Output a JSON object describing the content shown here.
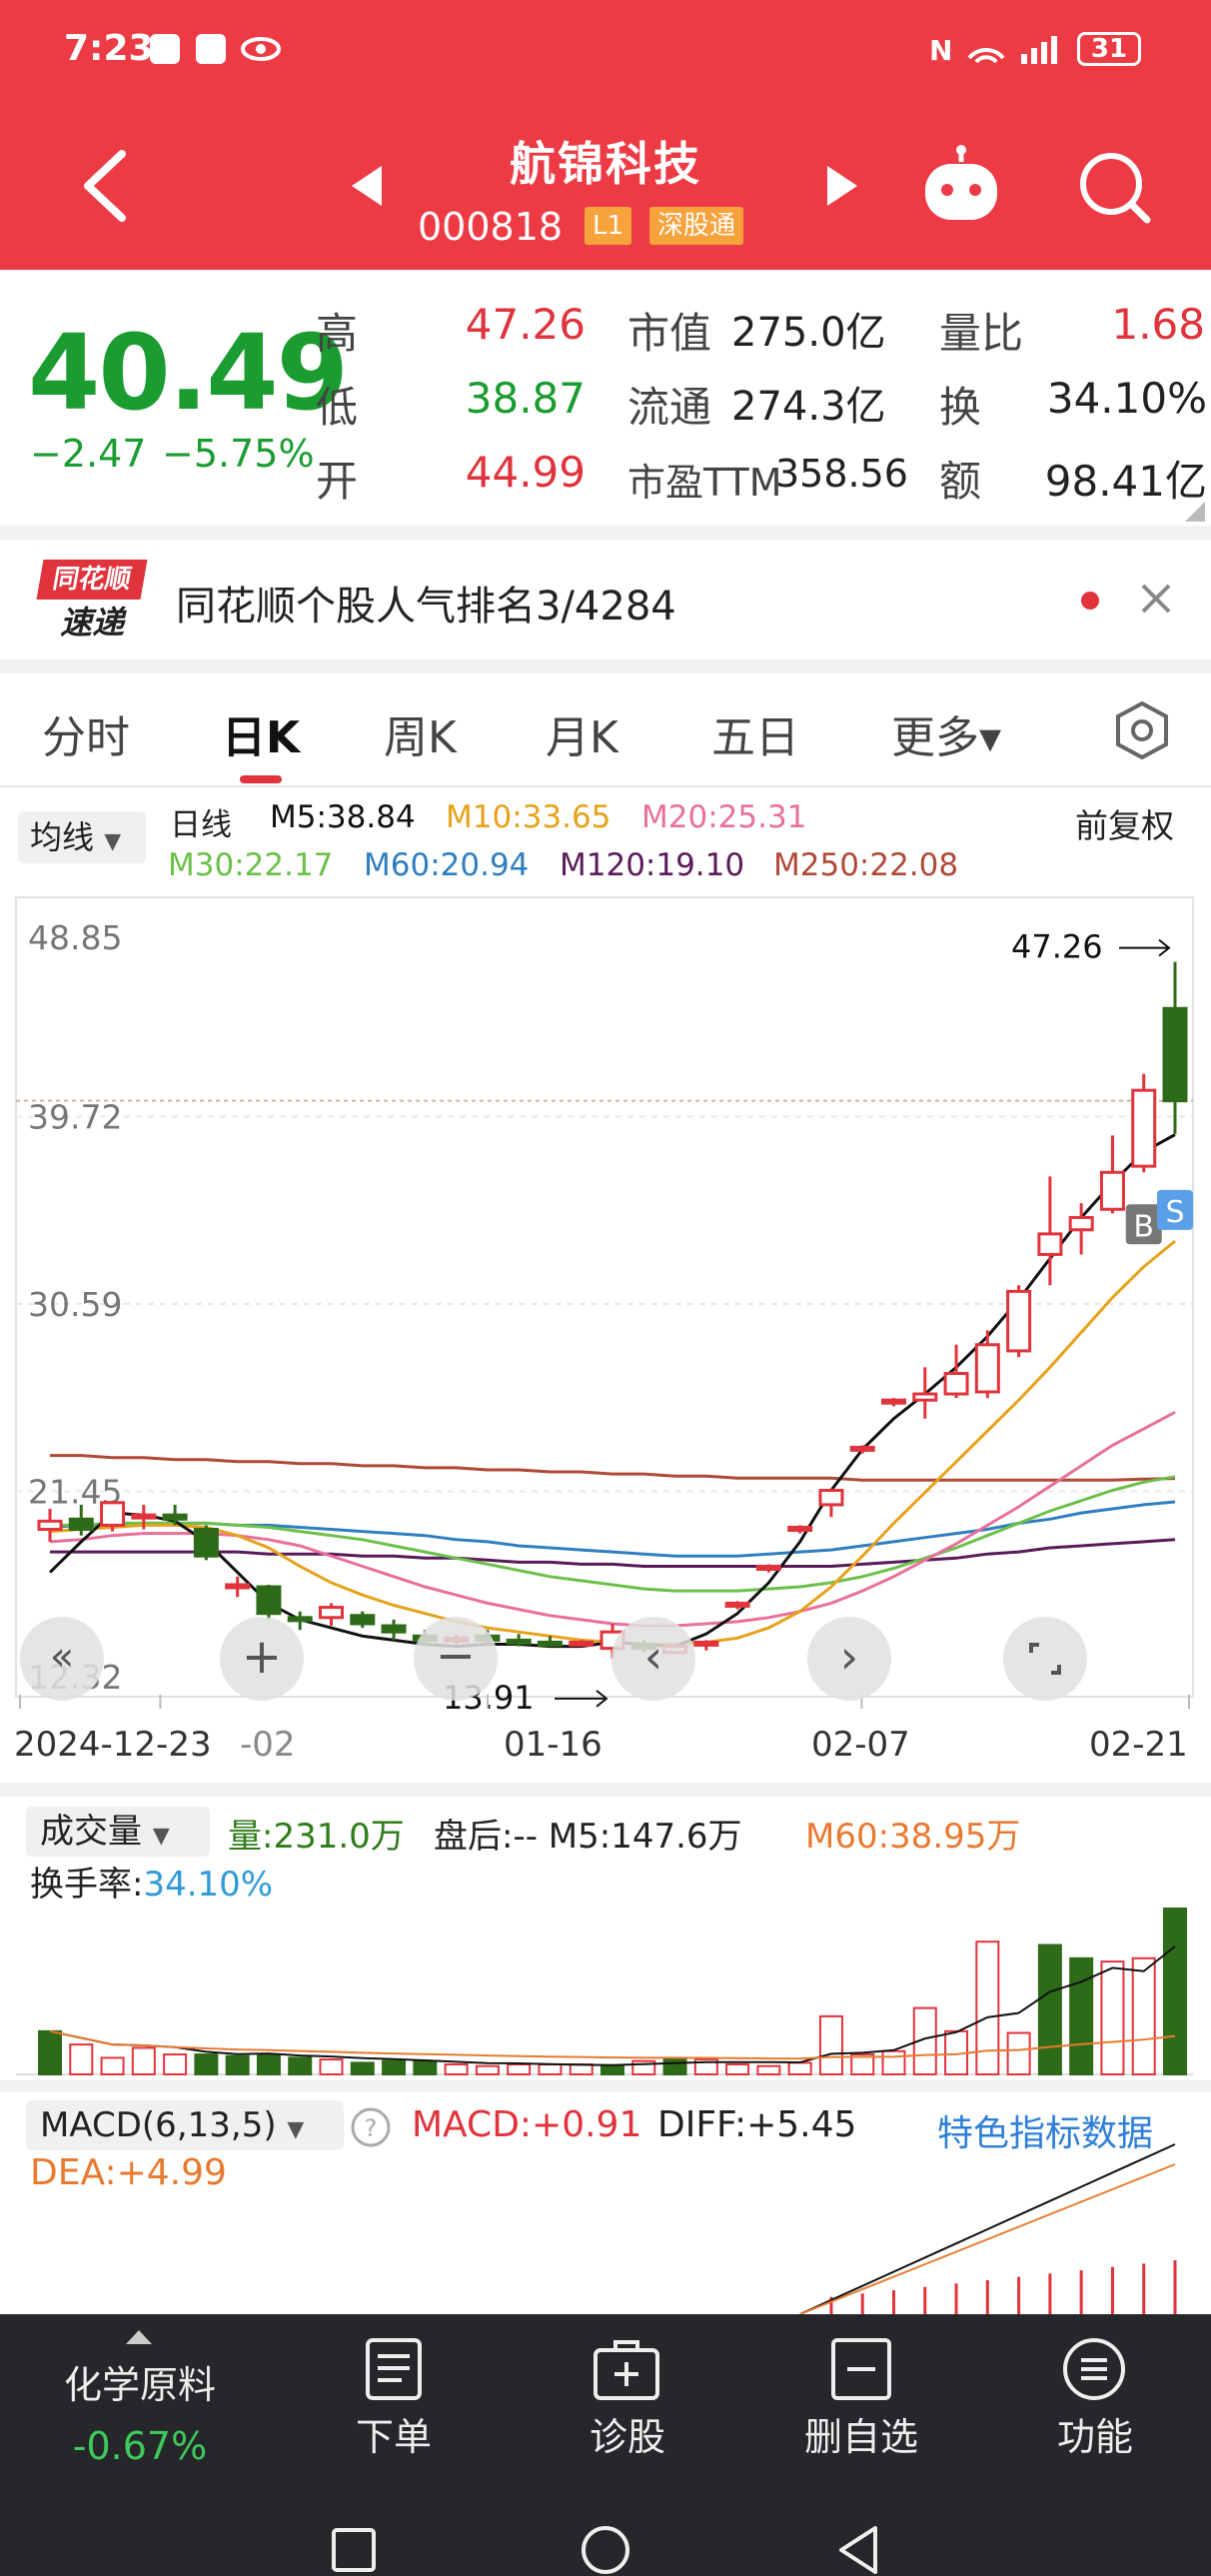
{
  "status_bar": {
    "time": "7:23",
    "battery": "31"
  },
  "header": {
    "stock_name": "航锦科技",
    "stock_code": "000818",
    "level_tag": "L1",
    "connect_tag": "深股通"
  },
  "quote": {
    "price": "40.49",
    "change": "−2.47",
    "change_pct": "−5.75%",
    "high_label": "高",
    "high": "47.26",
    "low_label": "低",
    "low": "38.87",
    "open_label": "开",
    "open": "44.99",
    "mktcap_label": "市值",
    "mktcap": "275.0亿",
    "float_label": "流通",
    "float": "274.3亿",
    "pe_label": "市盈TTM",
    "pe": "358.56",
    "volratio_label": "量比",
    "volratio": "1.68",
    "turnover_label": "换",
    "turnover": "34.10%",
    "amount_label": "额",
    "amount": "98.41亿"
  },
  "banner": {
    "logo_top": "同花顺",
    "logo_bottom": "速递",
    "text": "同花顺个股人气排名3/4284"
  },
  "tabs": [
    {
      "label": "分时"
    },
    {
      "label": "日K"
    },
    {
      "label": "周K"
    },
    {
      "label": "月K"
    },
    {
      "label": "五日"
    },
    {
      "label": "更多▾"
    }
  ],
  "indicator": {
    "selector": "均线",
    "period": "日线",
    "adjust": "前复权",
    "ma5": "M5:38.84",
    "ma10": "M10:33.65",
    "ma20": "M20:25.31",
    "ma30": "M30:22.17",
    "ma60": "M60:20.94",
    "ma120": "M120:19.10",
    "ma250": "M250:22.08"
  },
  "colors": {
    "ma5": "#111111",
    "ma10": "#e6a21a",
    "ma20": "#e8709a",
    "ma30": "#6cc04a",
    "ma60": "#2f7fc0",
    "ma120": "#5a1a5a",
    "ma250": "#b04a38",
    "up": "#e0333c",
    "down": "#2e6b18"
  },
  "chart_data": {
    "type": "candlestick",
    "y_ticks": [
      "48.85",
      "39.72",
      "30.59",
      "21.45",
      "12.32"
    ],
    "x_ticks": [
      "2024-12-23",
      "-02",
      "01-16",
      "02-07",
      "02-21"
    ],
    "high_marker": "47.26",
    "low_marker": "13.91",
    "buy_marker": "B",
    "sell_marker": "S",
    "ylim": [
      12.32,
      48.85
    ],
    "candles": [
      {
        "o": 19.6,
        "h": 20.6,
        "l": 19.0,
        "c": 20.0
      },
      {
        "o": 20.1,
        "h": 20.8,
        "l": 19.3,
        "c": 19.6
      },
      {
        "o": 19.8,
        "h": 21.0,
        "l": 19.5,
        "c": 20.9
      },
      {
        "o": 20.2,
        "h": 20.8,
        "l": 19.6,
        "c": 20.3
      },
      {
        "o": 20.3,
        "h": 20.8,
        "l": 19.8,
        "c": 20.1
      },
      {
        "o": 19.6,
        "h": 19.8,
        "l": 18.1,
        "c": 18.3
      },
      {
        "o": 16.8,
        "h": 17.3,
        "l": 16.3,
        "c": 16.9
      },
      {
        "o": 16.8,
        "h": 16.9,
        "l": 15.2,
        "c": 15.5
      },
      {
        "o": 15.3,
        "h": 15.6,
        "l": 14.7,
        "c": 15.2
      },
      {
        "o": 15.3,
        "h": 16.0,
        "l": 14.9,
        "c": 15.8
      },
      {
        "o": 15.4,
        "h": 15.6,
        "l": 14.8,
        "c": 15.0
      },
      {
        "o": 14.9,
        "h": 15.2,
        "l": 14.2,
        "c": 14.6
      },
      {
        "o": 14.4,
        "h": 14.7,
        "l": 13.9,
        "c": 14.2
      },
      {
        "o": 14.2,
        "h": 14.5,
        "l": 14.0,
        "c": 14.3
      },
      {
        "o": 14.4,
        "h": 14.7,
        "l": 14.0,
        "c": 14.2
      },
      {
        "o": 14.2,
        "h": 14.5,
        "l": 13.9,
        "c": 14.1
      },
      {
        "o": 14.1,
        "h": 14.4,
        "l": 13.9,
        "c": 14.0
      },
      {
        "o": 14.0,
        "h": 14.2,
        "l": 13.9,
        "c": 14.1
      },
      {
        "o": 13.8,
        "h": 15.0,
        "l": 13.3,
        "c": 14.6
      },
      {
        "o": 14.0,
        "h": 14.2,
        "l": 13.6,
        "c": 13.8
      },
      {
        "o": 13.6,
        "h": 14.0,
        "l": 13.5,
        "c": 13.9
      },
      {
        "o": 14.0,
        "h": 14.2,
        "l": 13.7,
        "c": 14.1
      },
      {
        "o": 15.9,
        "h": 16.1,
        "l": 15.7,
        "c": 16.0
      },
      {
        "o": 17.7,
        "h": 17.9,
        "l": 17.5,
        "c": 17.8
      },
      {
        "o": 19.6,
        "h": 19.8,
        "l": 19.4,
        "c": 19.7
      },
      {
        "o": 20.8,
        "h": 21.6,
        "l": 20.2,
        "c": 21.5
      },
      {
        "o": 23.5,
        "h": 23.7,
        "l": 23.3,
        "c": 23.6
      },
      {
        "o": 25.8,
        "h": 26.0,
        "l": 25.6,
        "c": 25.9
      },
      {
        "o": 25.9,
        "h": 27.5,
        "l": 25.0,
        "c": 26.2
      },
      {
        "o": 26.2,
        "h": 28.6,
        "l": 26.0,
        "c": 27.2
      },
      {
        "o": 26.3,
        "h": 29.3,
        "l": 26.0,
        "c": 28.6
      },
      {
        "o": 28.3,
        "h": 31.5,
        "l": 28.0,
        "c": 31.2
      },
      {
        "o": 33.0,
        "h": 36.8,
        "l": 31.5,
        "c": 34.0
      },
      {
        "o": 34.2,
        "h": 35.5,
        "l": 33.0,
        "c": 34.8
      },
      {
        "o": 35.2,
        "h": 38.8,
        "l": 35.0,
        "c": 37.0
      },
      {
        "o": 37.3,
        "h": 41.8,
        "l": 37.0,
        "c": 41.0
      },
      {
        "o": 44.99,
        "h": 47.26,
        "l": 38.87,
        "c": 40.49
      }
    ],
    "ma": {
      "ma5": [
        17.5,
        19.0,
        20.4,
        20.3,
        20.0,
        19.0,
        17.5,
        16.0,
        15.2,
        14.8,
        14.4,
        14.2,
        14.0,
        13.9,
        14.0,
        14.0,
        13.9,
        13.9,
        14.1,
        14.0,
        13.9,
        14.5,
        15.5,
        17.0,
        19.0,
        21.5,
        23.5,
        25.0,
        26.2,
        27.5,
        29.0,
        30.8,
        32.8,
        34.8,
        36.5,
        38.0,
        38.84
      ],
      "ma10": [
        19.5,
        19.6,
        19.7,
        19.8,
        19.8,
        19.7,
        19.3,
        18.7,
        17.8,
        17.0,
        16.4,
        15.9,
        15.5,
        15.1,
        14.8,
        14.6,
        14.4,
        14.2,
        14.1,
        14.0,
        14.0,
        14.1,
        14.3,
        14.8,
        15.6,
        16.8,
        18.3,
        19.9,
        21.4,
        22.9,
        24.4,
        25.9,
        27.5,
        29.2,
        30.9,
        32.4,
        33.65
      ],
      "ma20": [
        19.0,
        19.1,
        19.3,
        19.4,
        19.4,
        19.4,
        19.3,
        19.1,
        18.8,
        18.3,
        17.8,
        17.3,
        16.8,
        16.4,
        16.0,
        15.7,
        15.4,
        15.2,
        15.0,
        14.9,
        14.9,
        15.0,
        15.1,
        15.3,
        15.6,
        16.0,
        16.6,
        17.3,
        18.1,
        18.9,
        19.8,
        20.7,
        21.7,
        22.7,
        23.7,
        24.5,
        25.31
      ],
      "ma30": [
        19.8,
        19.8,
        19.9,
        19.9,
        19.9,
        19.9,
        19.8,
        19.7,
        19.5,
        19.3,
        19.1,
        18.8,
        18.5,
        18.2,
        17.9,
        17.6,
        17.3,
        17.1,
        16.9,
        16.7,
        16.6,
        16.6,
        16.6,
        16.7,
        16.8,
        17.0,
        17.3,
        17.7,
        18.2,
        18.7,
        19.3,
        19.9,
        20.5,
        21.0,
        21.5,
        21.9,
        22.17
      ],
      "ma60": [
        19.7,
        19.8,
        19.8,
        19.9,
        19.9,
        19.9,
        19.8,
        19.8,
        19.7,
        19.6,
        19.5,
        19.4,
        19.3,
        19.1,
        19.0,
        18.8,
        18.7,
        18.6,
        18.5,
        18.4,
        18.3,
        18.3,
        18.3,
        18.4,
        18.5,
        18.6,
        18.8,
        19.0,
        19.2,
        19.4,
        19.6,
        19.9,
        20.1,
        20.4,
        20.6,
        20.8,
        20.94
      ],
      "ma120": [
        18.5,
        18.5,
        18.5,
        18.5,
        18.5,
        18.5,
        18.5,
        18.4,
        18.4,
        18.4,
        18.3,
        18.3,
        18.2,
        18.2,
        18.1,
        18.0,
        18.0,
        17.9,
        17.9,
        17.8,
        17.8,
        17.8,
        17.8,
        17.8,
        17.8,
        17.8,
        17.9,
        18.0,
        18.1,
        18.2,
        18.4,
        18.5,
        18.7,
        18.8,
        18.9,
        19.0,
        19.1
      ],
      "ma250": [
        23.2,
        23.2,
        23.1,
        23.1,
        23.0,
        23.0,
        22.9,
        22.9,
        22.8,
        22.8,
        22.7,
        22.7,
        22.6,
        22.6,
        22.5,
        22.5,
        22.4,
        22.4,
        22.3,
        22.3,
        22.2,
        22.2,
        22.1,
        22.1,
        22.1,
        22.1,
        22.0,
        22.0,
        22.0,
        22.0,
        22.0,
        22.0,
        22.0,
        22.0,
        22.0,
        22.05,
        22.08
      ]
    },
    "volume": {
      "title": "成交量",
      "vol_label": "量:231.0万",
      "after_hours": "盘后:-- M5:147.6万",
      "m60_label": "M60:38.95万",
      "turnover_label": "换手率:",
      "turnover_value": "34.10%",
      "bars": [
        26,
        18,
        10,
        16,
        12,
        12,
        11,
        12,
        10,
        9,
        7,
        8,
        8,
        6,
        5,
        6,
        6,
        6,
        5,
        8,
        9,
        9,
        6,
        5,
        7,
        35,
        12,
        14,
        40,
        26,
        80,
        25,
        78,
        70,
        68,
        70,
        100
      ],
      "down_days": [
        0,
        5,
        6,
        7,
        8,
        10,
        11,
        12,
        18,
        20,
        32,
        33,
        36
      ]
    },
    "macd": {
      "selector": "MACD(6,13,5)",
      "macd_label": "MACD:+0.91",
      "diff_label": "DIFF:+5.45",
      "dea_label": "DEA:+4.99",
      "link": "特色指标数据"
    }
  },
  "bottom_bar": {
    "sector_name": "化学原料",
    "sector_change": "-0.67%",
    "items": [
      {
        "label": "下单"
      },
      {
        "label": "诊股"
      },
      {
        "label": "删自选"
      },
      {
        "label": "功能"
      }
    ]
  }
}
